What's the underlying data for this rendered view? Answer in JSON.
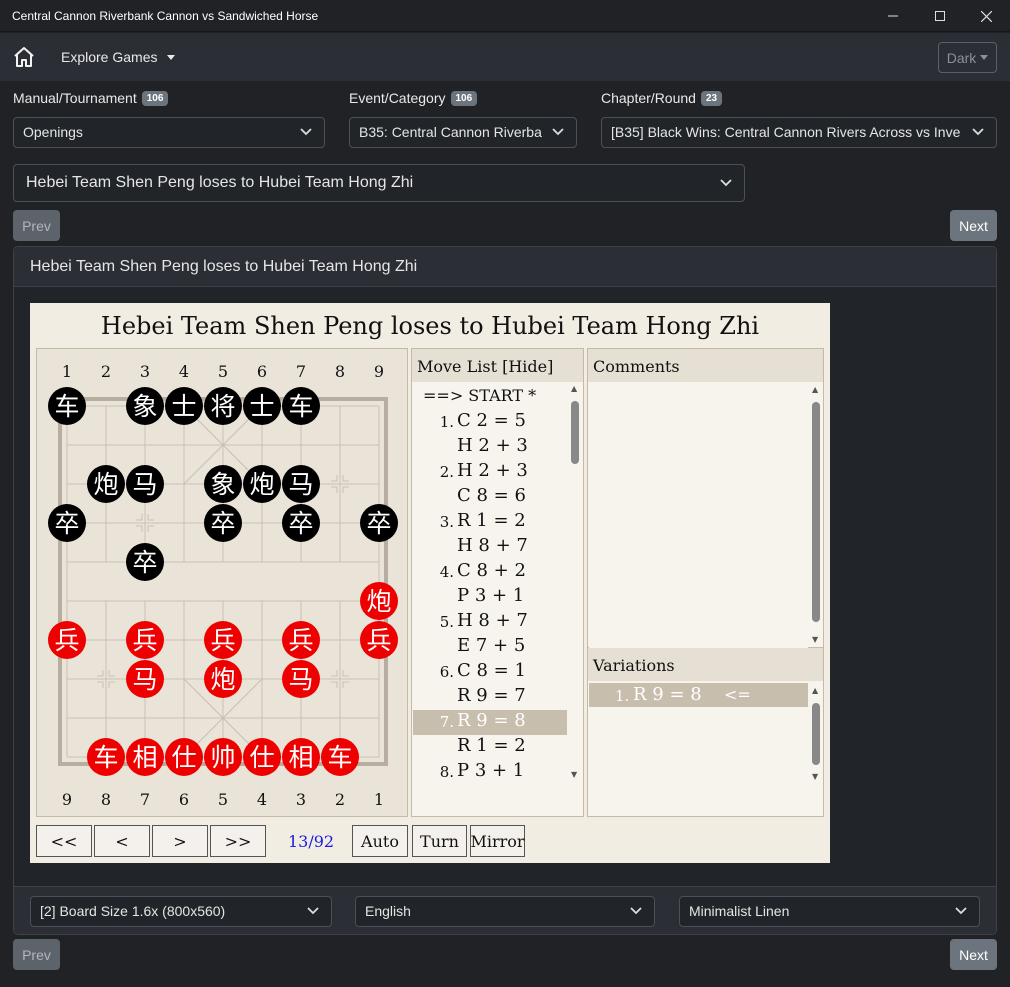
{
  "window": {
    "title": "Central Cannon Riverbank Cannon vs Sandwiched Horse"
  },
  "navbar": {
    "explore_label": "Explore Games",
    "theme_label": "Dark"
  },
  "filters": {
    "manual": {
      "label": "Manual/Tournament",
      "count": "106",
      "value": "Openings"
    },
    "event": {
      "label": "Event/Category",
      "count": "106",
      "value": "B35: Central Cannon Riverba"
    },
    "chapter": {
      "label": "Chapter/Round",
      "count": "23",
      "value": "[B35] Black Wins: Central Cannon Rivers Across vs Inve"
    }
  },
  "game_select": {
    "value": "Hebei Team Shen Peng loses to Hubei Team Hong Zhi"
  },
  "pager": {
    "prev": "Prev",
    "next": "Next"
  },
  "card": {
    "title": "Hebei Team Shen Peng loses to Hubei Team Hong Zhi"
  },
  "viewer": {
    "title": "Hebei Team Shen Peng loses to Hubei Team Hong Zhi",
    "top_files": [
      "1",
      "2",
      "3",
      "4",
      "5",
      "6",
      "7",
      "8",
      "9"
    ],
    "bottom_files": [
      "9",
      "8",
      "7",
      "6",
      "5",
      "4",
      "3",
      "2",
      "1"
    ],
    "pieces": [
      {
        "c": "b",
        "g": "车",
        "f": 0,
        "r": 0
      },
      {
        "c": "b",
        "g": "象",
        "f": 2,
        "r": 0
      },
      {
        "c": "b",
        "g": "士",
        "f": 3,
        "r": 0
      },
      {
        "c": "b",
        "g": "将",
        "f": 4,
        "r": 0
      },
      {
        "c": "b",
        "g": "士",
        "f": 5,
        "r": 0
      },
      {
        "c": "b",
        "g": "车",
        "f": 6,
        "r": 0
      },
      {
        "c": "b",
        "g": "炮",
        "f": 1,
        "r": 2
      },
      {
        "c": "b",
        "g": "马",
        "f": 2,
        "r": 2
      },
      {
        "c": "b",
        "g": "象",
        "f": 4,
        "r": 2
      },
      {
        "c": "b",
        "g": "炮",
        "f": 5,
        "r": 2
      },
      {
        "c": "b",
        "g": "马",
        "f": 6,
        "r": 2
      },
      {
        "c": "b",
        "g": "卒",
        "f": 0,
        "r": 3
      },
      {
        "c": "b",
        "g": "卒",
        "f": 4,
        "r": 3
      },
      {
        "c": "b",
        "g": "卒",
        "f": 6,
        "r": 3
      },
      {
        "c": "b",
        "g": "卒",
        "f": 8,
        "r": 3
      },
      {
        "c": "b",
        "g": "卒",
        "f": 2,
        "r": 4
      },
      {
        "c": "r",
        "g": "炮",
        "f": 8,
        "r": 5
      },
      {
        "c": "r",
        "g": "兵",
        "f": 0,
        "r": 6
      },
      {
        "c": "r",
        "g": "兵",
        "f": 2,
        "r": 6
      },
      {
        "c": "r",
        "g": "兵",
        "f": 4,
        "r": 6
      },
      {
        "c": "r",
        "g": "兵",
        "f": 6,
        "r": 6
      },
      {
        "c": "r",
        "g": "兵",
        "f": 8,
        "r": 6
      },
      {
        "c": "r",
        "g": "马",
        "f": 2,
        "r": 7
      },
      {
        "c": "r",
        "g": "炮",
        "f": 4,
        "r": 7
      },
      {
        "c": "r",
        "g": "马",
        "f": 6,
        "r": 7
      },
      {
        "c": "r",
        "g": "车",
        "f": 1,
        "r": 9
      },
      {
        "c": "r",
        "g": "相",
        "f": 2,
        "r": 9
      },
      {
        "c": "r",
        "g": "仕",
        "f": 3,
        "r": 9
      },
      {
        "c": "r",
        "g": "帅",
        "f": 4,
        "r": 9
      },
      {
        "c": "r",
        "g": "仕",
        "f": 5,
        "r": 9
      },
      {
        "c": "r",
        "g": "相",
        "f": 6,
        "r": 9
      },
      {
        "c": "r",
        "g": "车",
        "f": 7,
        "r": 9
      }
    ],
    "move_list": {
      "header": "Move List [Hide]",
      "start": "==> START *",
      "moves": [
        {
          "num": "1.",
          "text": "C 2 = 5"
        },
        {
          "num": "",
          "text": "H 2 + 3"
        },
        {
          "num": "2.",
          "text": "H 2 + 3"
        },
        {
          "num": "",
          "text": "C 8 = 6"
        },
        {
          "num": "3.",
          "text": "R 1 = 2"
        },
        {
          "num": "",
          "text": "H 8 + 7"
        },
        {
          "num": "4.",
          "text": "C 8 + 2"
        },
        {
          "num": "",
          "text": "P 3 + 1"
        },
        {
          "num": "5.",
          "text": "H 8 + 7"
        },
        {
          "num": "",
          "text": "E 7 + 5"
        },
        {
          "num": "6.",
          "text": "C 8 = 1"
        },
        {
          "num": "",
          "text": "R 9 = 7"
        },
        {
          "num": "7.",
          "text": "R 9 = 8",
          "selected": true
        },
        {
          "num": "",
          "text": "R 1 = 2"
        },
        {
          "num": "8.",
          "text": "P 3 + 1"
        }
      ]
    },
    "comments": {
      "header": "Comments"
    },
    "variations": {
      "header": "Variations",
      "items": [
        {
          "num": "1.",
          "text": "R 9 = 8",
          "marker": "<="
        }
      ]
    },
    "controls": {
      "first": "<<",
      "prev": "<",
      "next": ">",
      "last": ">>",
      "position": "13/92",
      "auto": "Auto",
      "turn": "Turn",
      "mirror": "Mirror"
    }
  },
  "footer": {
    "board_size": "[2] Board Size 1.6x (800x560)",
    "language": "English",
    "theme": "Minimalist Linen"
  },
  "colors": {
    "black_piece": "#000000",
    "red_piece": "#ee0000",
    "position_text": "#1a1ae0",
    "board_bg": "#e9e3d8"
  }
}
